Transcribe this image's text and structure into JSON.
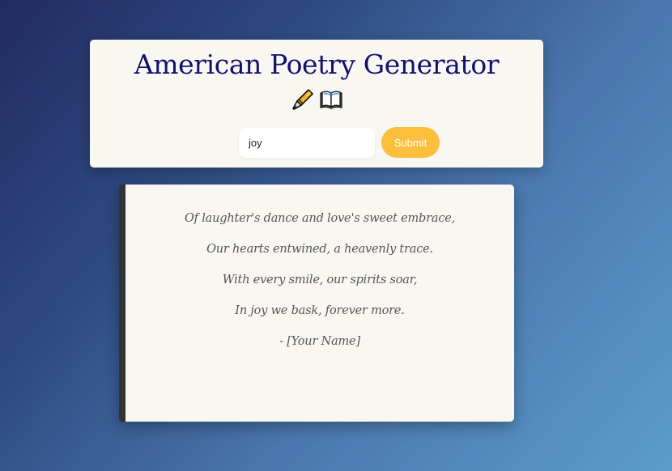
{
  "header": {
    "title": "American Poetry Generator",
    "icons": [
      "fountain-pen-icon",
      "open-book-icon"
    ]
  },
  "form": {
    "topic_value": "joy",
    "submit_label": "Submit"
  },
  "poem": {
    "lines": [
      "Of laughter's dance and love's sweet embrace,",
      "Our hearts entwined, a heavenly trace.",
      "With every smile, our spirits soar,",
      "In joy we bask, forever more.",
      "- [Your Name]"
    ]
  },
  "colors": {
    "title": "#12116f",
    "accent": "#fbbf3b",
    "card_background": "#f9f7f1",
    "poem_text": "#555555",
    "poem_border": "#333333"
  }
}
